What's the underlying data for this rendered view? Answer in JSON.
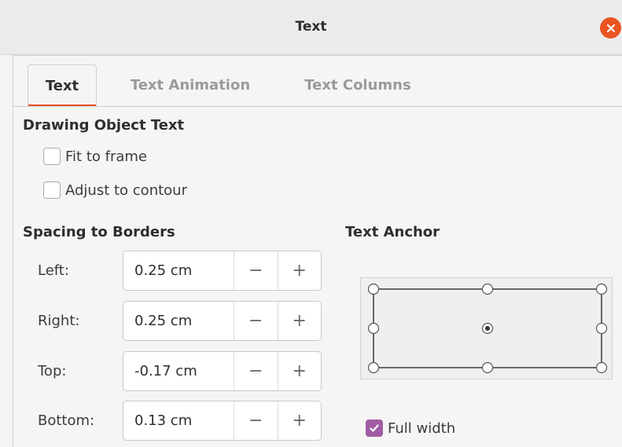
{
  "window": {
    "title": "Text"
  },
  "tabs": [
    {
      "label": "Text",
      "active": true
    },
    {
      "label": "Text Animation",
      "active": false
    },
    {
      "label": "Text Columns",
      "active": false
    }
  ],
  "drawing_object_text": {
    "heading": "Drawing Object Text",
    "fit_to_frame": {
      "label": "Fit to frame",
      "checked": false
    },
    "adjust_to_contour": {
      "label": "Adjust to contour",
      "checked": false
    }
  },
  "spacing": {
    "heading": "Spacing to Borders",
    "left": {
      "label": "Left:",
      "value": "0.25 cm"
    },
    "right": {
      "label": "Right:",
      "value": "0.25 cm"
    },
    "top": {
      "label": "Top:",
      "value": "-0.17 cm"
    },
    "bottom": {
      "label": "Bottom:",
      "value": "0.13 cm"
    },
    "decrement_symbol": "−",
    "increment_symbol": "+"
  },
  "anchor": {
    "heading": "Text Anchor",
    "selected": "center",
    "full_width": {
      "label": "Full width",
      "checked": true
    }
  },
  "colors": {
    "accent": "#e95420",
    "check": "#a15ca3"
  },
  "icons": {
    "close": "close-icon",
    "check": "checkmark-icon"
  }
}
